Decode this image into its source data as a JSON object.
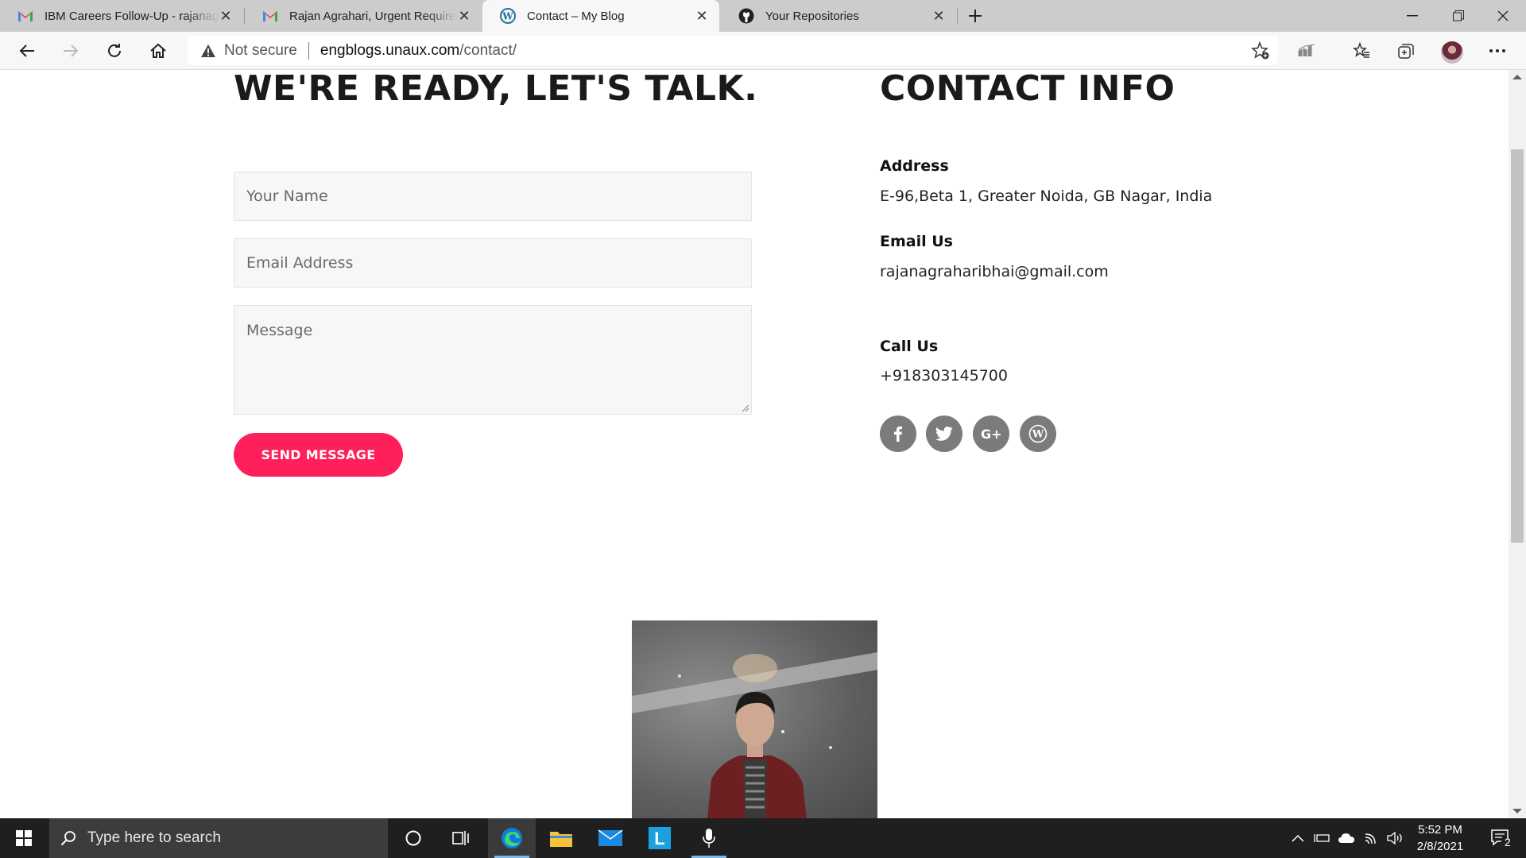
{
  "browser": {
    "tabs": [
      {
        "title": "IBM Careers Follow-Up - rajanagraharibhai",
        "icon": "gmail-icon",
        "active": false
      },
      {
        "title": "Rajan Agrahari, Urgent Requirement",
        "icon": "gmail-icon",
        "active": false
      },
      {
        "title": "Contact – My Blog",
        "icon": "wordpress-icon",
        "active": true
      },
      {
        "title": "Your Repositories",
        "icon": "github-icon",
        "active": false
      }
    ],
    "security_label": "Not secure",
    "url_host": "engblogs.unaux.com",
    "url_path": "/contact/"
  },
  "contact_form": {
    "heading": "WE'RE READY, LET'S TALK.",
    "name_placeholder": "Your Name",
    "email_placeholder": "Email Address",
    "message_placeholder": "Message",
    "send_label": "SEND MESSAGE"
  },
  "contact_info": {
    "heading": "CONTACT INFO",
    "address_label": "Address",
    "address_value": "E-96,Beta 1, Greater Noida, GB Nagar, India",
    "email_label": "Email Us",
    "email_value": "rajanagraharibhai@gmail.com",
    "call_label": "Call Us",
    "call_value": "+918303145700",
    "social": [
      "facebook-icon",
      "twitter-icon",
      "google-plus-icon",
      "wordpress-icon"
    ]
  },
  "taskbar": {
    "search_placeholder": "Type here to search",
    "time": "5:52 PM",
    "date": "2/8/2021",
    "notification_count": "2"
  },
  "colors": {
    "accent": "#ff1f5a",
    "social_bg": "#7b7b7b",
    "taskbar": "#1f1f1f"
  }
}
